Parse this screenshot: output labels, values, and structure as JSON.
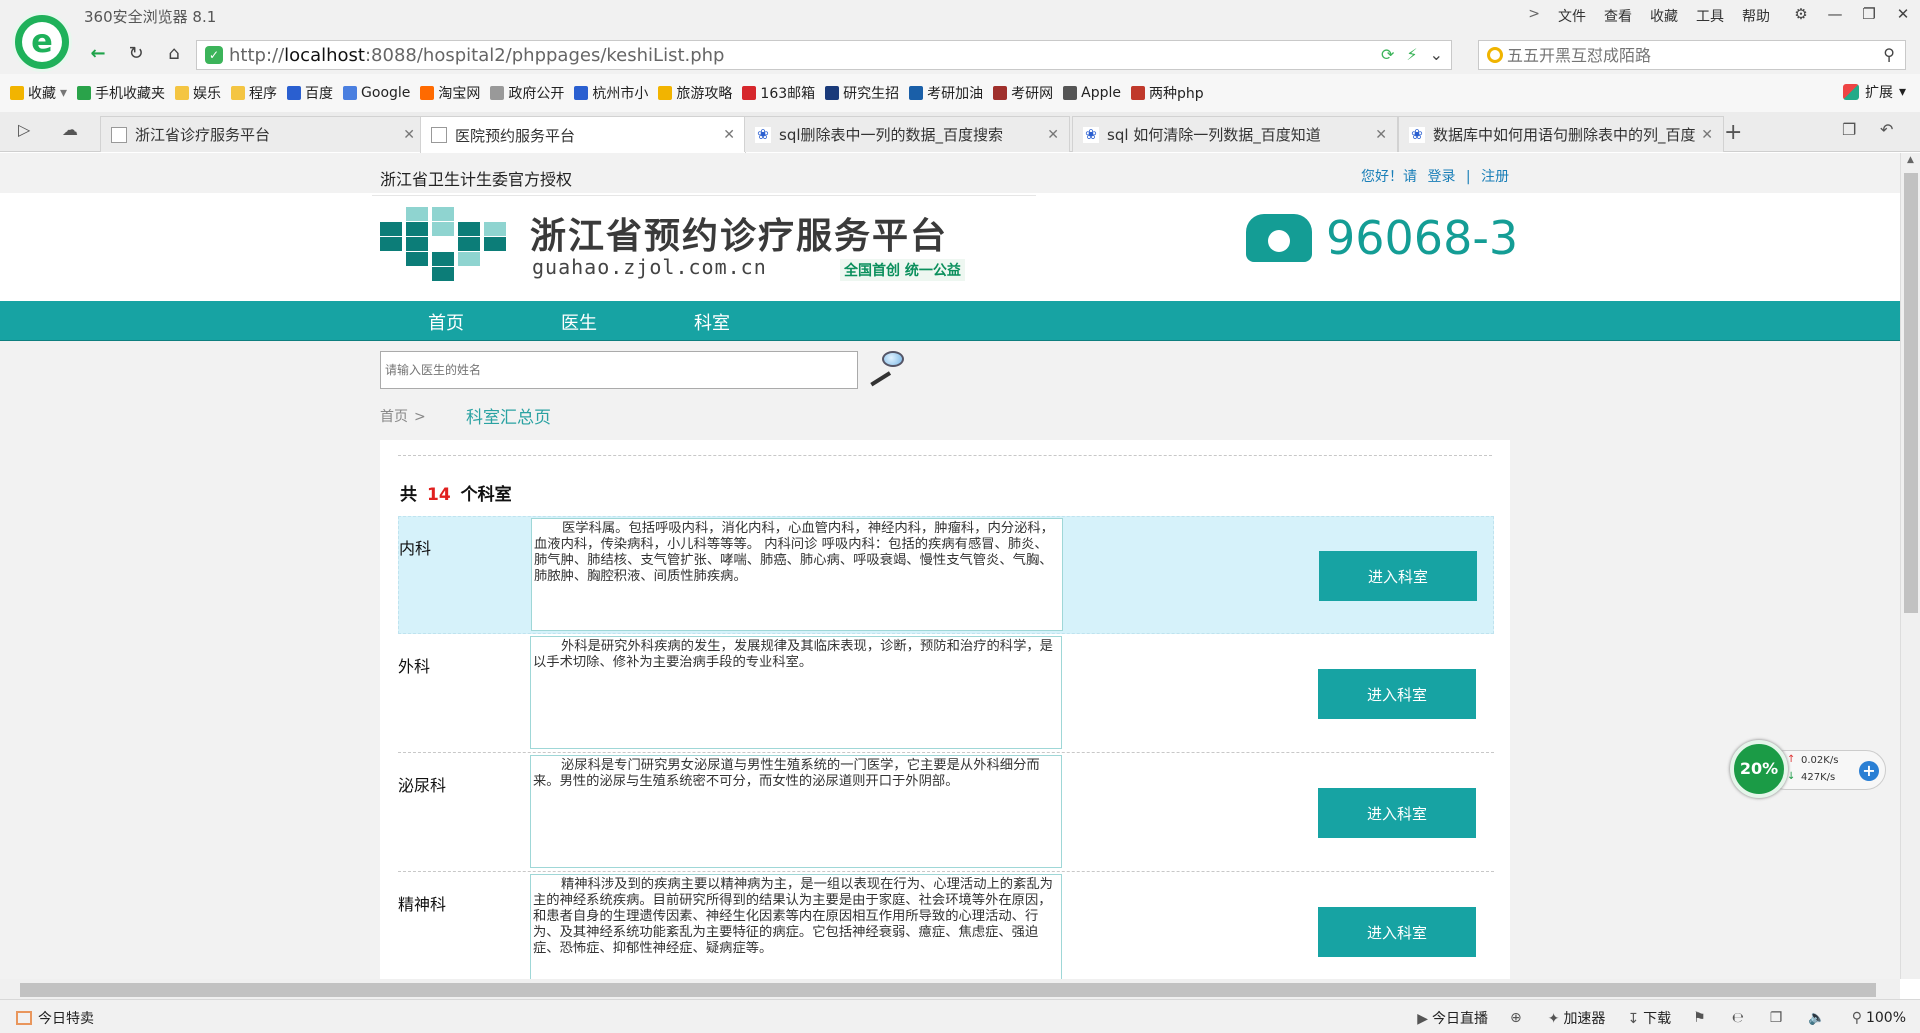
{
  "browser": {
    "title": "360安全浏览器 8.1",
    "menu": [
      "文件",
      "查看",
      "收藏",
      "工具",
      "帮助"
    ],
    "url_host": "localhost",
    "url_prefix": "http://",
    "url_rest": ":8088/hospital2/phppages/keshiList.php",
    "search_placeholder": "五五开黑互怼成陌路"
  },
  "bookmarks": [
    {
      "label": "收藏",
      "color": "#f2b400"
    },
    {
      "label": "手机收藏夹",
      "color": "#2aa34a"
    },
    {
      "label": "娱乐",
      "color": "#f4c542"
    },
    {
      "label": "程序",
      "color": "#f4c542"
    },
    {
      "label": "百度",
      "color": "#2a5fd0"
    },
    {
      "label": "Google",
      "color": "#4a7fe0"
    },
    {
      "label": "淘宝网",
      "color": "#ff6a00"
    },
    {
      "label": "政府公开",
      "color": "#999999"
    },
    {
      "label": "杭州市小",
      "color": "#2a5fd0"
    },
    {
      "label": "旅游攻略",
      "color": "#f2b400"
    },
    {
      "label": "163邮箱",
      "color": "#d6272c"
    },
    {
      "label": "研究生招",
      "color": "#1a3a7a"
    },
    {
      "label": "考研加油",
      "color": "#1a5fa8"
    },
    {
      "label": "考研网",
      "color": "#a0302c"
    },
    {
      "label": "Apple",
      "color": "#555555"
    },
    {
      "label": "两种php",
      "color": "#c0392b"
    }
  ],
  "extensions_label": "扩展",
  "tabs": [
    {
      "label": "浙江省诊疗服务平台",
      "active": false
    },
    {
      "label": "医院预约服务平台",
      "active": true
    },
    {
      "label": "sql删除表中一列的数据_百度搜索",
      "active": false
    },
    {
      "label": "sql 如何清除一列数据_百度知道",
      "active": false
    },
    {
      "label": "数据库中如何用语句删除表中的列_百度",
      "active": false
    }
  ],
  "page": {
    "auth_text": "浙江省卫生计生委官方授权",
    "greeting": "您好！请",
    "login": "登录",
    "divider": "|",
    "register": "注册",
    "site_title": "浙江省预约诊疗服务平台",
    "site_domain": "guahao.zjol.com.cn",
    "site_slogan": "全国首创  统一公益",
    "hotline": "96068-3",
    "nav": [
      "首页",
      "医生",
      "科室"
    ],
    "doctor_search_placeholder": "请输入医生的姓名",
    "breadcrumb_home": "首页",
    "breadcrumb_sep": ">",
    "breadcrumb_current": "科室汇总页",
    "total_prefix": "共",
    "total_count": "14",
    "total_suffix": "个科室",
    "enter_label": "进入科室",
    "departments": [
      {
        "name": "内科",
        "desc": "医学科属。包括呼吸内科，消化内科，心血管内科，神经内科，肿瘤科，内分泌科，血液内科，传染病科，小儿科等等等。 内科问诊 呼吸内科：包括的疾病有感冒、肺炎、肺气肿、肺结核、支气管扩张、哮喘、肺癌、肺心病、呼吸衰竭、慢性支气管炎、气胸、肺脓肿、胸腔积液、间质性肺疾病。"
      },
      {
        "name": "外科",
        "desc": "外科是研究外科疾病的发生，发展规律及其临床表现，诊断，预防和治疗的科学，是以手术切除、修补为主要治病手段的专业科室。"
      },
      {
        "name": "泌尿科",
        "desc": "泌尿科是专门研究男女泌尿道与男性生殖系统的一门医学，它主要是从外科细分而来。男性的泌尿与生殖系统密不可分，而女性的泌尿道则开口于外阴部。"
      },
      {
        "name": "精神科",
        "desc": "精神科涉及到的疾病主要以精神病为主，是一组以表现在行为、心理活动上的紊乱为主的神经系统疾病。目前研究所得到的结果认为主要是由于家庭、社会环境等外在原因，和患者自身的生理遗传因素、神经生化因素等内在原因相互作用所导致的心理活动、行为、及其神经系统功能紊乱为主要特征的病症。它包括神经衰弱、癔症、焦虑症、强迫症、恐怖症、抑郁性神经症、疑病症等。"
      }
    ]
  },
  "speed_widget": {
    "percent": "20%",
    "up": "0.02K/s",
    "down": "427K/s"
  },
  "status": {
    "left": "今日特卖",
    "items": [
      "今日直播",
      "",
      "加速器",
      "下载",
      "",
      "",
      "",
      "",
      "100%"
    ]
  },
  "colors": {
    "teal": "#17a3a3",
    "highlight_row": "#d6f2fa",
    "count_red": "#e0201f"
  }
}
